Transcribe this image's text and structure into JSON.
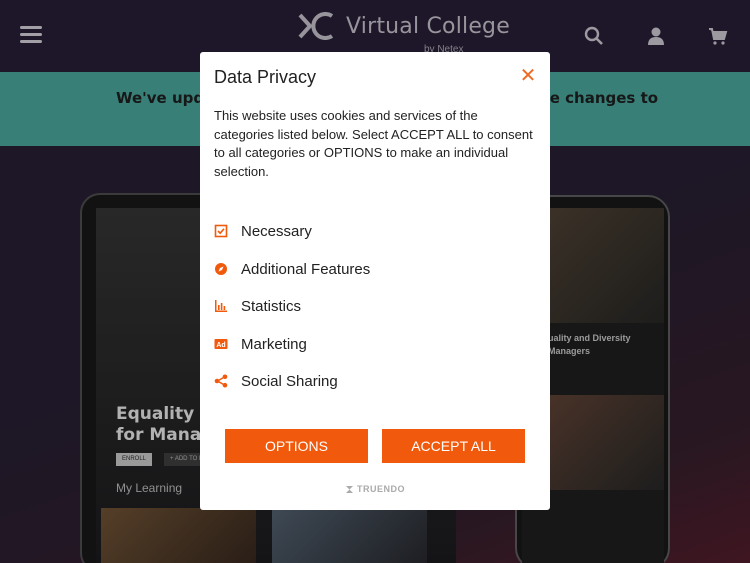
{
  "header": {
    "logo_text": "Virtual College",
    "logo_sub": "by Netex",
    "icons": [
      "menu-icon",
      "search-icon",
      "user-icon",
      "cart-icon"
    ]
  },
  "banner": {
    "left_text": "We've upd",
    "right_text": "de changes to"
  },
  "background": {
    "tablet_title_1": "Equality a",
    "tablet_title_2": "for Manag",
    "tablet_enroll": "ENROLL",
    "tablet_add": "+ ADD TO M",
    "tablet_my_learning": "My Learning",
    "phone_title_1": "uality and Diversity",
    "phone_title_2": "Managers"
  },
  "modal": {
    "title": "Data Privacy",
    "description": "This website uses cookies and services of the categories listed below. Select ACCEPT ALL to consent to all categories or OPTIONS to make an individual selection.",
    "categories": [
      {
        "label": "Necessary",
        "icon": "checkbox-icon"
      },
      {
        "label": "Additional Features",
        "icon": "compass-icon"
      },
      {
        "label": "Statistics",
        "icon": "bar-chart-icon"
      },
      {
        "label": "Marketing",
        "icon": "ad-icon"
      },
      {
        "label": "Social Sharing",
        "icon": "share-icon"
      }
    ],
    "options_label": "OPTIONS",
    "accept_label": "ACCEPT ALL",
    "brand": "TRUENDO"
  },
  "colors": {
    "accent": "#f15a0d",
    "header_bg": "#2b223c",
    "banner_bg": "#4fb6ab"
  }
}
